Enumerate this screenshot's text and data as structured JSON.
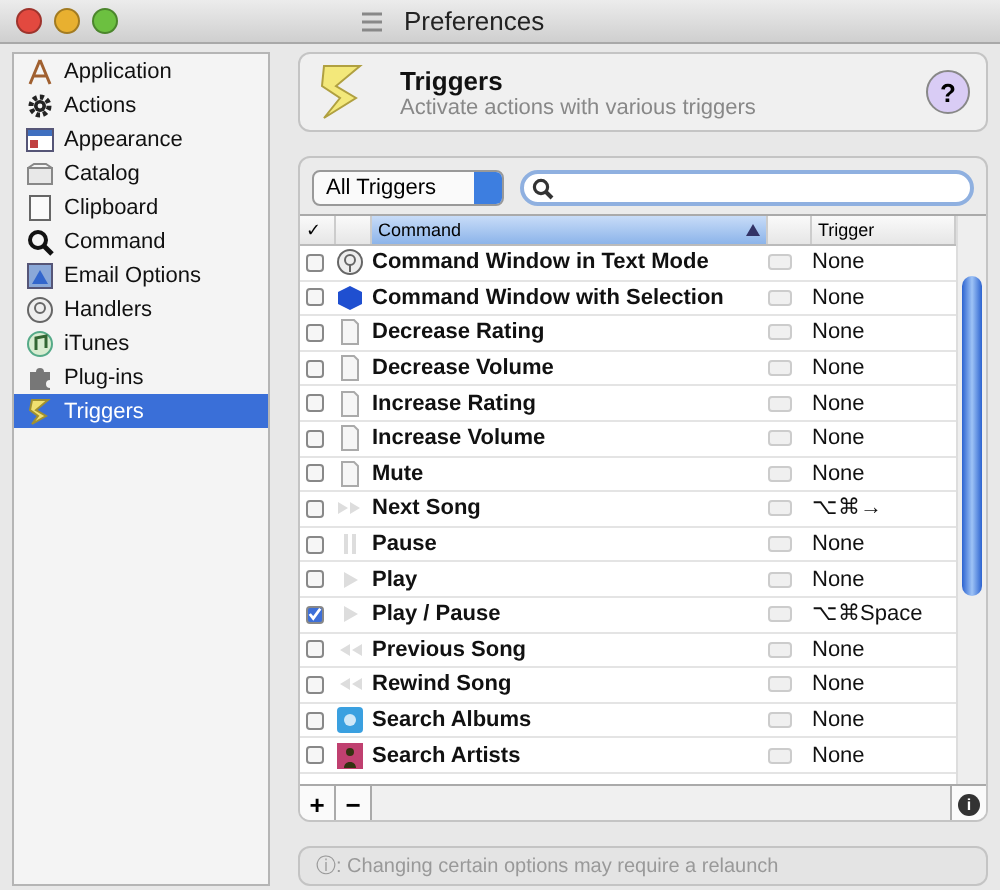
{
  "window": {
    "title": "Preferences"
  },
  "sidebar": {
    "items": [
      {
        "label": "Application",
        "kind": "app",
        "selected": false
      },
      {
        "label": "Actions",
        "kind": "gear",
        "selected": false
      },
      {
        "label": "Appearance",
        "kind": "appearance",
        "selected": false
      },
      {
        "label": "Catalog",
        "kind": "catalog",
        "selected": false
      },
      {
        "label": "Clipboard",
        "kind": "clipboard",
        "selected": false
      },
      {
        "label": "Command",
        "kind": "search",
        "selected": false
      },
      {
        "label": "Email Options",
        "kind": "email",
        "selected": false
      },
      {
        "label": "Handlers",
        "kind": "handler",
        "selected": false
      },
      {
        "label": "iTunes",
        "kind": "note",
        "selected": false
      },
      {
        "label": "Plug-ins",
        "kind": "puzzle",
        "selected": false
      },
      {
        "label": "Triggers",
        "kind": "bolt",
        "selected": true
      }
    ]
  },
  "header": {
    "title": "Triggers",
    "subtitle": "Activate actions with various triggers",
    "help": "?"
  },
  "filter": {
    "popup": "All Triggers"
  },
  "table": {
    "columns": [
      "✓",
      "Command",
      "Trigger"
    ],
    "rows": [
      {
        "checked": false,
        "kind": "handler",
        "command": "Command Window in Text Mode",
        "trigger": "None"
      },
      {
        "checked": false,
        "kind": "cube",
        "command": "Command Window with Selection",
        "trigger": "None"
      },
      {
        "checked": false,
        "kind": "script",
        "command": "Decrease Rating",
        "trigger": "None"
      },
      {
        "checked": false,
        "kind": "script",
        "command": "Decrease Volume",
        "trigger": "None"
      },
      {
        "checked": false,
        "kind": "script",
        "command": "Increase Rating",
        "trigger": "None"
      },
      {
        "checked": false,
        "kind": "script",
        "command": "Increase Volume",
        "trigger": "None"
      },
      {
        "checked": false,
        "kind": "script",
        "command": "Mute",
        "trigger": "None"
      },
      {
        "checked": false,
        "kind": "next",
        "command": "Next Song",
        "trigger": "⌥⌘→"
      },
      {
        "checked": false,
        "kind": "pause",
        "command": "Pause",
        "trigger": "None"
      },
      {
        "checked": false,
        "kind": "play",
        "command": "Play",
        "trigger": "None"
      },
      {
        "checked": true,
        "kind": "play",
        "command": "Play / Pause",
        "trigger": "⌥⌘Space"
      },
      {
        "checked": false,
        "kind": "prev",
        "command": "Previous Song",
        "trigger": "None"
      },
      {
        "checked": false,
        "kind": "prev",
        "command": "Rewind Song",
        "trigger": "None"
      },
      {
        "checked": false,
        "kind": "album",
        "command": "Search Albums",
        "trigger": "None"
      },
      {
        "checked": false,
        "kind": "artist",
        "command": "Search Artists",
        "trigger": "None"
      }
    ]
  },
  "toolbar": {
    "add": "+",
    "remove": "−",
    "info": "i"
  },
  "note": "ⓘ: Changing certain options may require a relaunch"
}
